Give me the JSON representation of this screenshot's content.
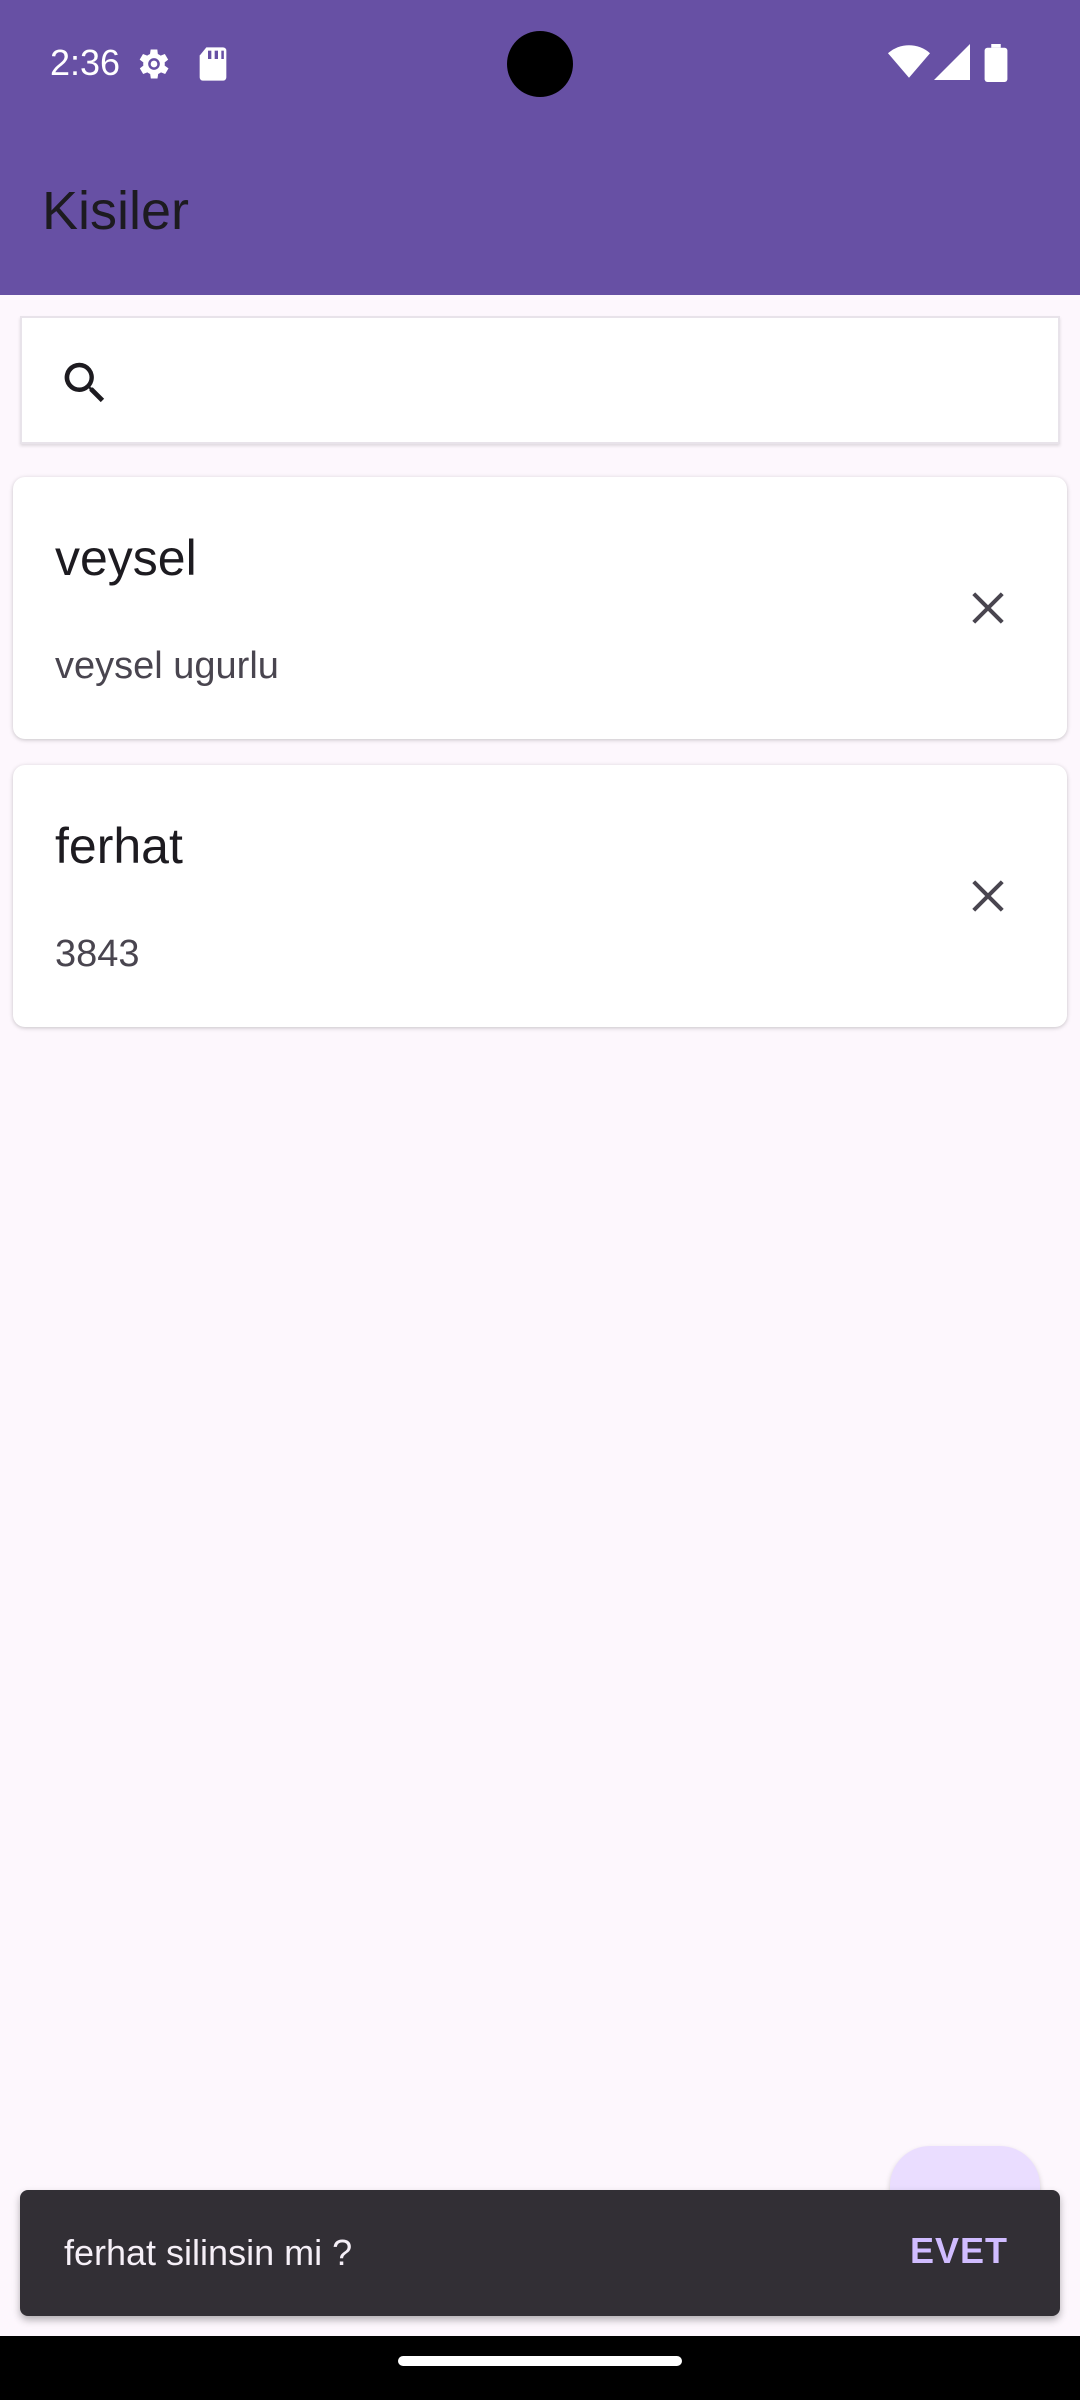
{
  "status_bar": {
    "time": "2:36",
    "icons": [
      "gear-icon",
      "sd-card-icon",
      "wifi-icon",
      "signal-icon",
      "battery-icon"
    ]
  },
  "app_bar": {
    "title": "Kisiler",
    "color": "#6750a4"
  },
  "search": {
    "icon": "search-icon",
    "value": "",
    "placeholder": ""
  },
  "contacts": [
    {
      "name": "veysel",
      "detail": "veysel ugurlu",
      "action_icon": "close-icon"
    },
    {
      "name": "ferhat",
      "detail": "3843",
      "action_icon": "close-icon"
    }
  ],
  "snackbar": {
    "message": "ferhat silinsin mi ?",
    "action_label": "EVET",
    "action_color": "#d0bcff"
  },
  "colors": {
    "background": "#fdf7fd",
    "fab": "#eaddff",
    "snackbar": "#322f35"
  }
}
